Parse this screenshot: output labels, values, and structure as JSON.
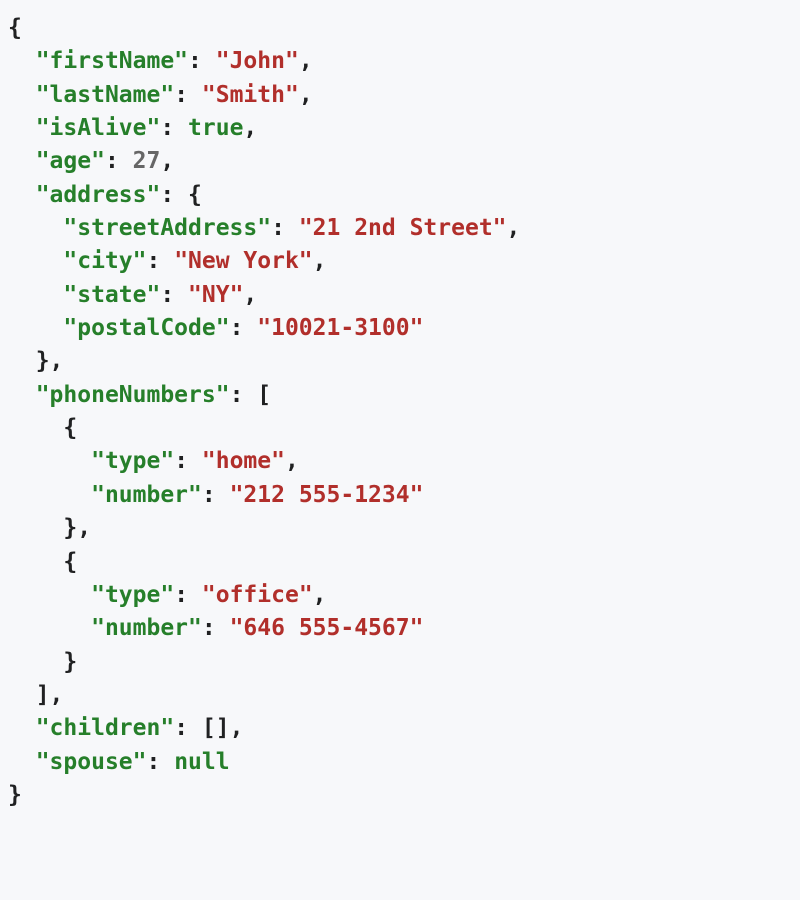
{
  "tokens": [
    {
      "cls": "p",
      "text": "{",
      "br": true
    },
    {
      "cls": "p",
      "text": "  "
    },
    {
      "cls": "k",
      "text": "\"firstName\""
    },
    {
      "cls": "p",
      "text": ": "
    },
    {
      "cls": "s",
      "text": "\"John\""
    },
    {
      "cls": "p",
      "text": ",",
      "br": true
    },
    {
      "cls": "p",
      "text": "  "
    },
    {
      "cls": "k",
      "text": "\"lastName\""
    },
    {
      "cls": "p",
      "text": ": "
    },
    {
      "cls": "s",
      "text": "\"Smith\""
    },
    {
      "cls": "p",
      "text": ",",
      "br": true
    },
    {
      "cls": "p",
      "text": "  "
    },
    {
      "cls": "k",
      "text": "\"isAlive\""
    },
    {
      "cls": "p",
      "text": ": "
    },
    {
      "cls": "kw",
      "text": "true"
    },
    {
      "cls": "p",
      "text": ",",
      "br": true
    },
    {
      "cls": "p",
      "text": "  "
    },
    {
      "cls": "k",
      "text": "\"age\""
    },
    {
      "cls": "p",
      "text": ": "
    },
    {
      "cls": "n",
      "text": "27"
    },
    {
      "cls": "p",
      "text": ",",
      "br": true
    },
    {
      "cls": "p",
      "text": "  "
    },
    {
      "cls": "k",
      "text": "\"address\""
    },
    {
      "cls": "p",
      "text": ": {",
      "br": true
    },
    {
      "cls": "p",
      "text": "    "
    },
    {
      "cls": "k",
      "text": "\"streetAddress\""
    },
    {
      "cls": "p",
      "text": ": "
    },
    {
      "cls": "s",
      "text": "\"21 2nd Street\""
    },
    {
      "cls": "p",
      "text": ",",
      "br": true
    },
    {
      "cls": "p",
      "text": "    "
    },
    {
      "cls": "k",
      "text": "\"city\""
    },
    {
      "cls": "p",
      "text": ": "
    },
    {
      "cls": "s",
      "text": "\"New York\""
    },
    {
      "cls": "p",
      "text": ",",
      "br": true
    },
    {
      "cls": "p",
      "text": "    "
    },
    {
      "cls": "k",
      "text": "\"state\""
    },
    {
      "cls": "p",
      "text": ": "
    },
    {
      "cls": "s",
      "text": "\"NY\""
    },
    {
      "cls": "p",
      "text": ",",
      "br": true
    },
    {
      "cls": "p",
      "text": "    "
    },
    {
      "cls": "k",
      "text": "\"postalCode\""
    },
    {
      "cls": "p",
      "text": ": "
    },
    {
      "cls": "s",
      "text": "\"10021-3100\""
    },
    {
      "cls": "p",
      "text": "",
      "br": true
    },
    {
      "cls": "p",
      "text": "  },",
      "br": true
    },
    {
      "cls": "p",
      "text": "  "
    },
    {
      "cls": "k",
      "text": "\"phoneNumbers\""
    },
    {
      "cls": "p",
      "text": ": [",
      "br": true
    },
    {
      "cls": "p",
      "text": "    {",
      "br": true
    },
    {
      "cls": "p",
      "text": "      "
    },
    {
      "cls": "k",
      "text": "\"type\""
    },
    {
      "cls": "p",
      "text": ": "
    },
    {
      "cls": "s",
      "text": "\"home\""
    },
    {
      "cls": "p",
      "text": ",",
      "br": true
    },
    {
      "cls": "p",
      "text": "      "
    },
    {
      "cls": "k",
      "text": "\"number\""
    },
    {
      "cls": "p",
      "text": ": "
    },
    {
      "cls": "s",
      "text": "\"212 555-1234\""
    },
    {
      "cls": "p",
      "text": "",
      "br": true
    },
    {
      "cls": "p",
      "text": "    },",
      "br": true
    },
    {
      "cls": "p",
      "text": "    {",
      "br": true
    },
    {
      "cls": "p",
      "text": "      "
    },
    {
      "cls": "k",
      "text": "\"type\""
    },
    {
      "cls": "p",
      "text": ": "
    },
    {
      "cls": "s",
      "text": "\"office\""
    },
    {
      "cls": "p",
      "text": ",",
      "br": true
    },
    {
      "cls": "p",
      "text": "      "
    },
    {
      "cls": "k",
      "text": "\"number\""
    },
    {
      "cls": "p",
      "text": ": "
    },
    {
      "cls": "s",
      "text": "\"646 555-4567\""
    },
    {
      "cls": "p",
      "text": "",
      "br": true
    },
    {
      "cls": "p",
      "text": "    }",
      "br": true
    },
    {
      "cls": "p",
      "text": "  ],",
      "br": true
    },
    {
      "cls": "p",
      "text": "  "
    },
    {
      "cls": "k",
      "text": "\"children\""
    },
    {
      "cls": "p",
      "text": ": [],",
      "br": true
    },
    {
      "cls": "p",
      "text": "  "
    },
    {
      "cls": "k",
      "text": "\"spouse\""
    },
    {
      "cls": "p",
      "text": ": "
    },
    {
      "cls": "kw",
      "text": "null"
    },
    {
      "cls": "p",
      "text": "",
      "br": true
    },
    {
      "cls": "p",
      "text": "}",
      "br": true
    }
  ]
}
